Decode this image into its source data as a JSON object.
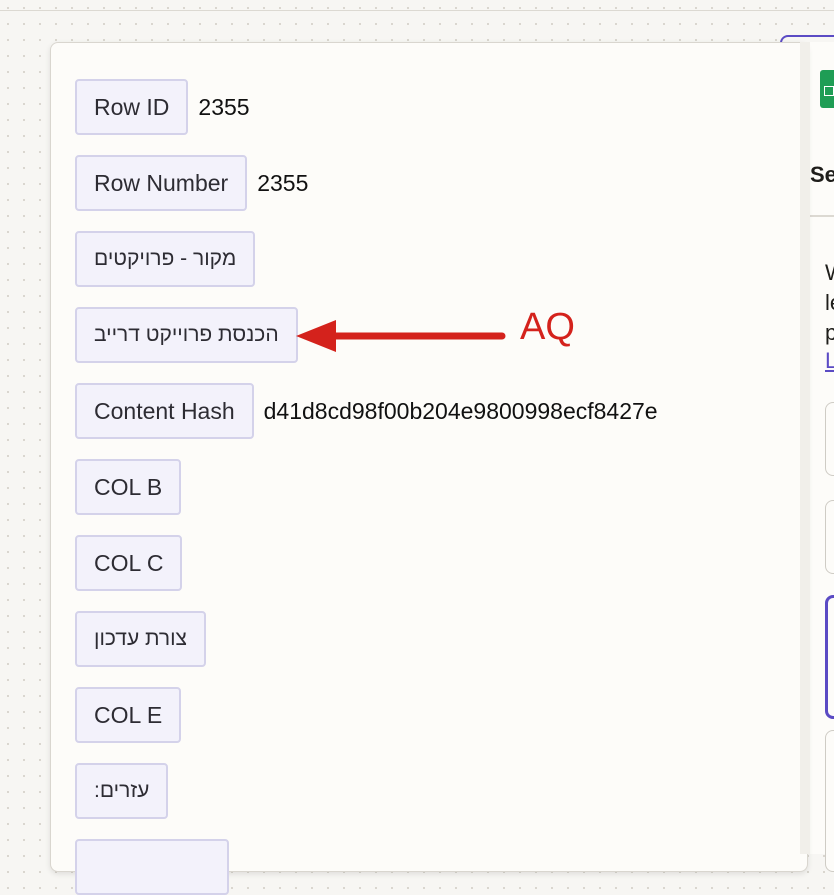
{
  "fields": [
    {
      "label": "Row ID",
      "value": "2355",
      "rtl": false
    },
    {
      "label": "Row Number",
      "value": "2355",
      "rtl": false
    },
    {
      "label": "מקור - פרויקטים",
      "value": "",
      "rtl": true
    },
    {
      "label": "הכנסת פרוייקט דרייב",
      "value": "",
      "rtl": true
    },
    {
      "label": "Content Hash",
      "value": "d41d8cd98f00b204e9800998ecf8427e",
      "rtl": false
    },
    {
      "label": "COL B",
      "value": "",
      "rtl": false
    },
    {
      "label": "COL C",
      "value": "",
      "rtl": false
    },
    {
      "label": "צורת עדכון",
      "value": "",
      "rtl": true
    },
    {
      "label": "COL E",
      "value": "",
      "rtl": false
    },
    {
      "label": "עזרים:",
      "value": "",
      "rtl": true
    }
  ],
  "annotation": {
    "label": "AQ",
    "color": "#d4221c"
  },
  "side_panel": {
    "title_fragment": "Se",
    "text_line_1": "W",
    "text_line_2": "le",
    "text_line_3": "p",
    "link_fragment": "L",
    "icon": "google-sheets-icon",
    "accent_color": "#5b4bc4"
  }
}
